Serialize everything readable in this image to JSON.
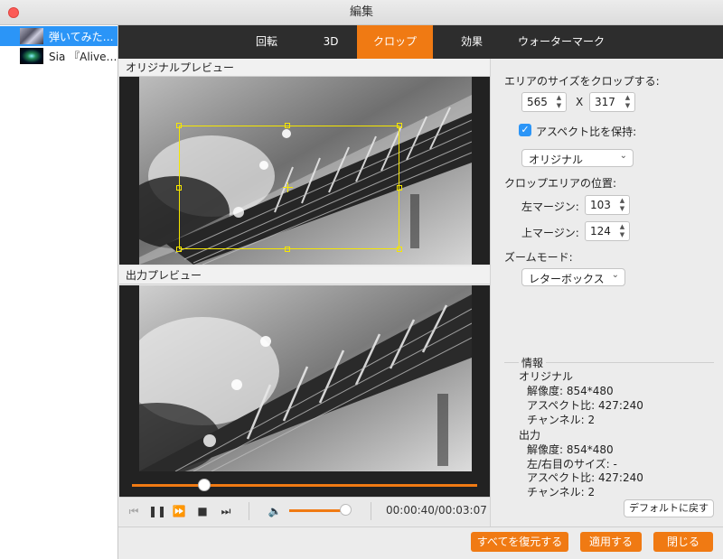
{
  "window": {
    "title": "編集"
  },
  "sidebar": {
    "files": [
      {
        "name": "弾いてみた…",
        "selected": true
      },
      {
        "name": "Sia 『Alive…",
        "selected": false
      }
    ]
  },
  "tabs": [
    {
      "label": "回転",
      "active": false
    },
    {
      "label": "3D",
      "active": false
    },
    {
      "label": "クロップ",
      "active": true
    },
    {
      "label": "効果",
      "active": false
    },
    {
      "label": "ウォーターマーク",
      "active": false
    }
  ],
  "preview": {
    "original_label": "オリジナルプレビュー",
    "output_label": "出力プレビュー"
  },
  "player": {
    "progress": 0.21,
    "volume": 0.85,
    "timecode": "00:00:40/00:03:07"
  },
  "crop": {
    "size_label": "エリアのサイズをクロップする:",
    "width": "565",
    "times": "X",
    "height": "317",
    "keep_aspect_checked": true,
    "keep_aspect_label": "アスペクト比を保持:",
    "aspect_option": "オリジナル",
    "position_label": "クロップエリアの位置:",
    "left_margin_label": "左マージン:",
    "left_margin": "103",
    "top_margin_label": "上マージン:",
    "top_margin": "124",
    "zoom_label": "ズームモード:",
    "zoom_option": "レターボックス"
  },
  "info": {
    "title": "情報",
    "original_heading": "オリジナル",
    "original_resolution": "解像度: 854*480",
    "original_aspect": "アスペクト比: 427:240",
    "original_channels": "チャンネル: 2",
    "output_heading": "出力",
    "output_resolution": "解像度: 854*480",
    "output_lr_size": "左/右目のサイズ: -",
    "output_aspect": "アスペクト比: 427:240",
    "output_channels": "チャンネル: 2"
  },
  "buttons": {
    "default": "デフォルトに戻す",
    "restore_all": "すべてを復元する",
    "apply": "適用する",
    "close": "閉じる"
  },
  "colors": {
    "accent": "#f07a13",
    "selection": "#2b95f7",
    "crop_frame": "#f5e600"
  }
}
